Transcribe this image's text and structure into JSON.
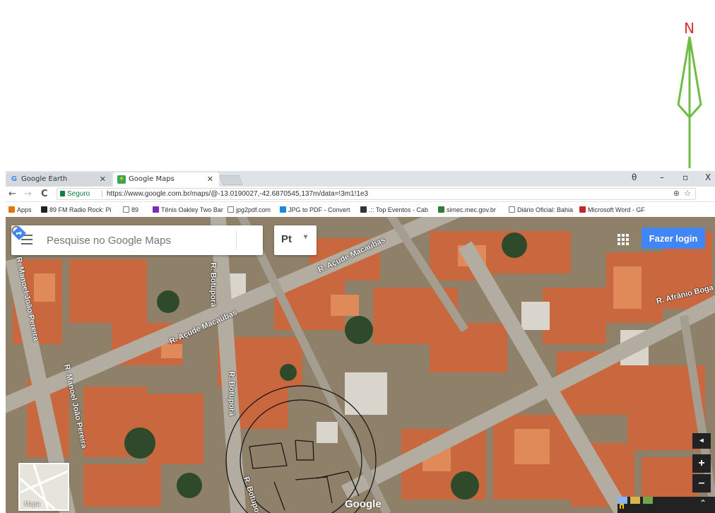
{
  "north": {
    "letter": "N",
    "color": "#e0302b",
    "arrow_color": "#6fbe44"
  },
  "browser": {
    "tabs": [
      {
        "label": "Google Earth",
        "active": false
      },
      {
        "label": "Google Maps",
        "active": true
      }
    ],
    "window_controls": {
      "account": "θ",
      "minimize": "–",
      "restore": "▫",
      "close": "X"
    },
    "nav": {
      "back": "←",
      "forward": "→",
      "reload": "C"
    },
    "address": {
      "security_label": "Seguro",
      "url": "https://www.google.com.br/maps/@-13.0190027,-42.6870545,137m/data=!3m1!1e3",
      "zoom_icon": "⊕",
      "star_icon": "☆"
    },
    "bookmarks": [
      "Apps",
      "89 FM Radio Rock: Pi",
      "89",
      "Tênis Oakley Two Bar",
      "jpg2pdf.com",
      "JPG to PDF - Convert",
      ".:: Top Eventos - Cab",
      "simec.mec.gov.br",
      "Diário Oficial: Bahia",
      "Microsoft Word - GF"
    ]
  },
  "map": {
    "search": {
      "placeholder": "Pesquise no Google Maps"
    },
    "language": {
      "value": "Pt",
      "chevron": "▾"
    },
    "login_label": "Fazer login",
    "streets": [
      "R. Açude Macaúbas",
      "R. Açude Macaúbas",
      "R. Botuporã",
      "R. Botuporã",
      "R. Botuporã",
      "R. Manoel João Pereira",
      "R. Manoel João Pereira",
      "R. Afrânio Boga"
    ],
    "mode_label": "Mapa",
    "logo": "Google",
    "zoom": {
      "in": "+",
      "out": "–",
      "compass": "◂"
    },
    "expand": "⌃"
  }
}
